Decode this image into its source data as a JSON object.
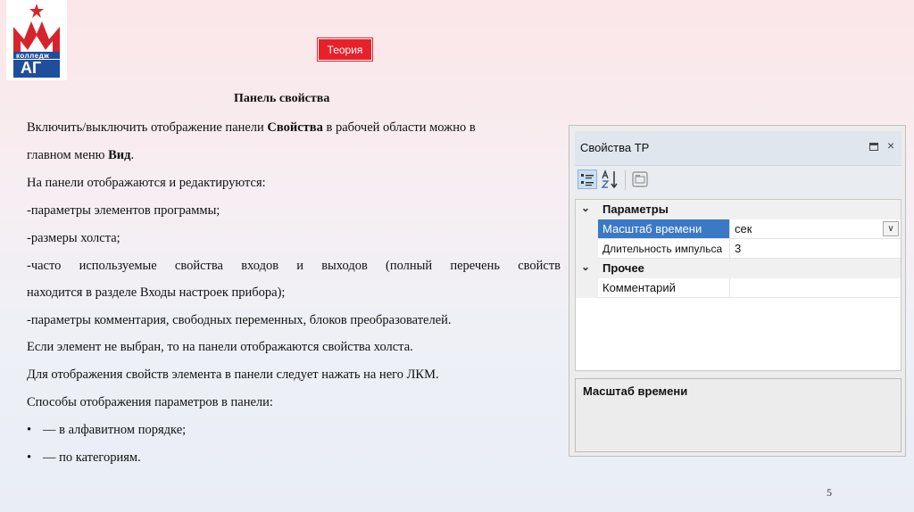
{
  "logo": {
    "text_top": "колледж",
    "text_bottom": "АГ"
  },
  "theory_button": "Теория",
  "slide": {
    "title": "Панель свойства",
    "paragraphs": [
      {
        "before": "Включить/выключить отображение панели ",
        "bold": "Свойства",
        "after": " в рабочей области можно в"
      },
      {
        "before": "главном меню ",
        "bold": "Вид",
        "after": "."
      },
      "На панели отображаются и редактируются:",
      "-параметры элементов программы;",
      "-размеры холста;",
      "-часто используемые свойства входов и выходов (полный перечень свойств",
      "находится в разделе Входы настроек прибора);",
      "-параметры комментария, свободных переменных, блоков преобразователей.",
      "Если элемент не выбран, то на панели отображаются свойства холста.",
      "Для отображения свойств элемента в панели следует нажать на него ЛКМ.",
      "Способы отображения параметров в панели:"
    ],
    "bullets": [
      "— в алфавитном порядке;",
      "— по категориям."
    ],
    "bullet_symbol": "•",
    "page_number": "5"
  },
  "panel": {
    "title": "Свойства ТР",
    "close_symbol": "×",
    "categories": [
      {
        "label": "Параметры",
        "props": [
          {
            "name": "Масштаб времени",
            "value": "сек",
            "selected": true,
            "dropdown": true
          },
          {
            "name": "Длительность импульса",
            "value": "3",
            "selected": false,
            "dropdown": false
          }
        ]
      },
      {
        "label": "Прочее",
        "props": [
          {
            "name": "Комментарий",
            "value": "",
            "selected": false,
            "dropdown": false
          }
        ]
      }
    ],
    "description_title": "Масштаб времени",
    "accent_color": "#3b79c6"
  },
  "colors": {
    "theory_button": "#e8202a",
    "logo_red": "#d7242c",
    "logo_blue": "#1f4e9c"
  }
}
